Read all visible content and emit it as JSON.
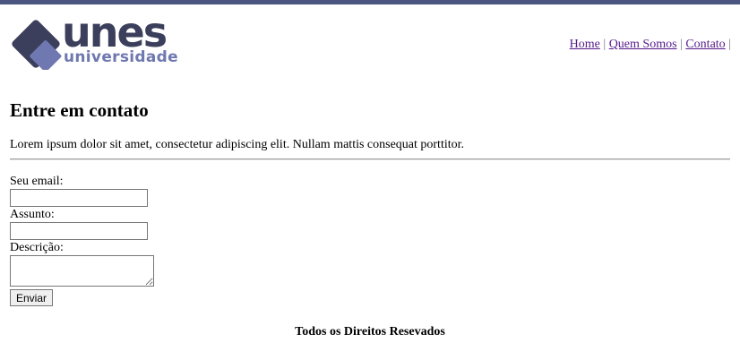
{
  "brand": {
    "name": "unes",
    "tagline": "universidade",
    "colors": {
      "dark": "#3b3f5c",
      "light": "#6f78b0"
    }
  },
  "nav": {
    "items": [
      "Home",
      "Quem Somos",
      "Contato"
    ],
    "separator": "|"
  },
  "page": {
    "title": "Entre em contato",
    "intro": "Lorem ipsum dolor sit amet, consectetur adipiscing elit. Nullam mattis consequat porttitor."
  },
  "form": {
    "email_label": "Seu email:",
    "email_value": "",
    "subject_label": "Assunto:",
    "subject_value": "",
    "description_label": "Descrição:",
    "description_value": "",
    "submit_label": "Enviar"
  },
  "footer": {
    "text": "Todos os Direitos Resevados"
  }
}
